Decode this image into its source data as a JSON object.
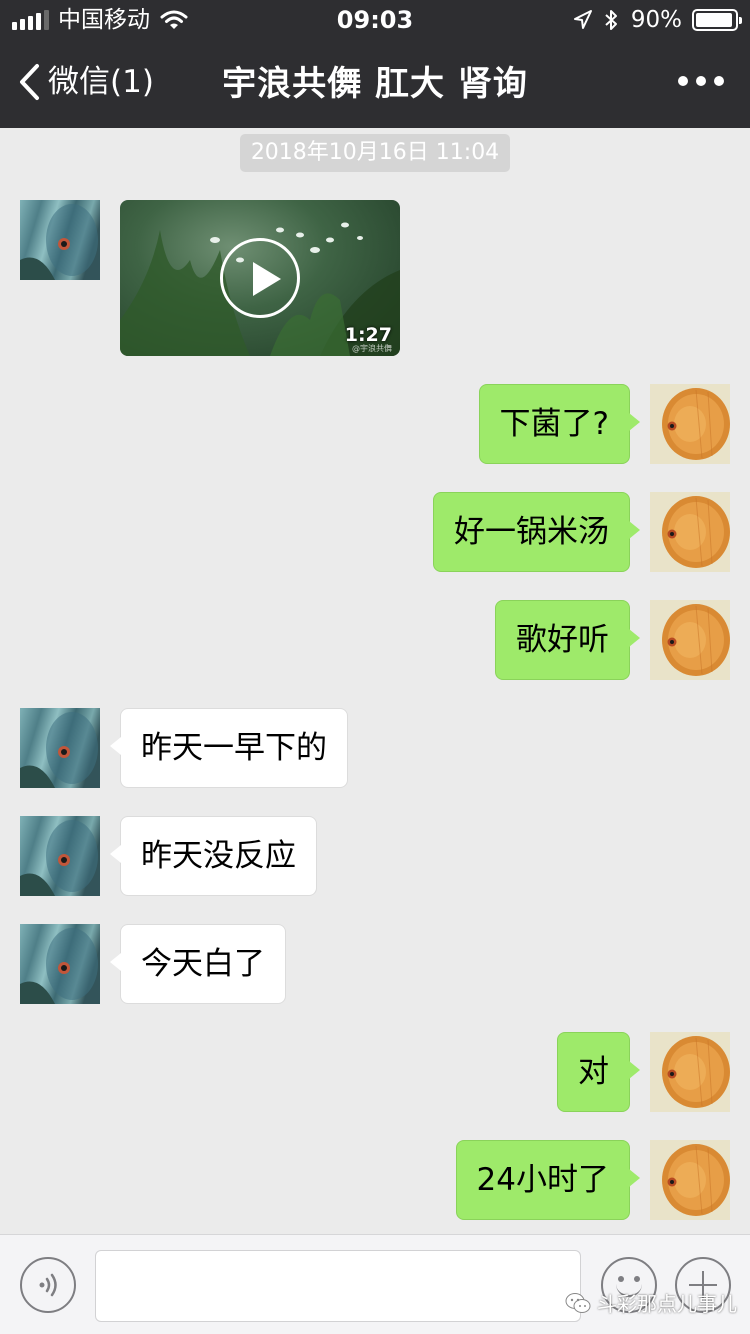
{
  "status_bar": {
    "carrier": "中国移动",
    "time": "09:03",
    "battery_percent": "90%",
    "battery_level": 0.9
  },
  "nav": {
    "back_label": "微信(1)",
    "title": "宇浪共儛 肛大 肾询"
  },
  "timestamp": "2018年10月16日 11:04",
  "messages": [
    {
      "side": "left",
      "type": "video",
      "duration": "1:27",
      "watermark": "@宇浪共儛"
    },
    {
      "side": "right",
      "type": "text",
      "text": "下菌了?"
    },
    {
      "side": "right",
      "type": "text",
      "text": "好一锅米汤"
    },
    {
      "side": "right",
      "type": "text",
      "text": "歌好听"
    },
    {
      "side": "left",
      "type": "text",
      "text": "昨天一早下的"
    },
    {
      "side": "left",
      "type": "text",
      "text": "昨天没反应"
    },
    {
      "side": "left",
      "type": "text",
      "text": "今天白了"
    },
    {
      "side": "right",
      "type": "text",
      "text": "对"
    },
    {
      "side": "right",
      "type": "text",
      "text": "24小时了"
    }
  ],
  "input_bar": {
    "voice_icon": "voice-icon",
    "emoji_icon": "emoji-icon",
    "plus_icon": "plus-icon"
  },
  "watermark": "斗彩那点儿事儿",
  "colors": {
    "header_bg": "#2e2e31",
    "chat_bg": "#ebebeb",
    "sent_bubble": "#9eea6a",
    "recv_bubble": "#ffffff"
  }
}
